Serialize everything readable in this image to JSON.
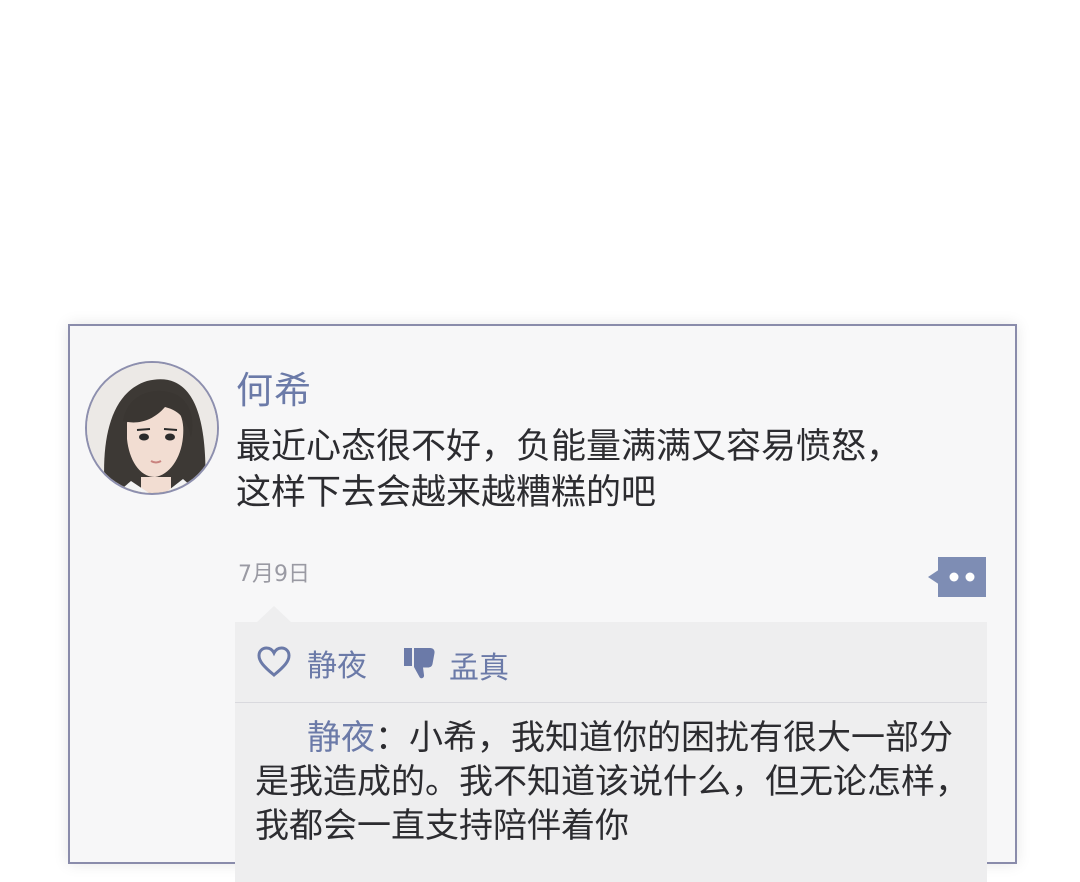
{
  "post": {
    "username": "何希",
    "text": "最近心态很不好，负能量满满又容易愤怒，\n这样下去会越来越糟糕的吧",
    "date": "7月9日"
  },
  "reactions": {
    "like_icon": "heart-icon",
    "like_name": "静夜",
    "dislike_icon": "thumbs-down-icon",
    "dislike_name": "孟真"
  },
  "reply": {
    "author": "静夜",
    "separator": "：",
    "text": "小希，我知道你的困扰有很大一部分是我造成的。我不知道该说什么，但无论怎样，我都会一直支持陪伴着你"
  },
  "colors": {
    "accent": "#6b7aa8",
    "card_border": "#8a8cab",
    "text": "#2c2c30",
    "date": "#9a9aa3"
  }
}
